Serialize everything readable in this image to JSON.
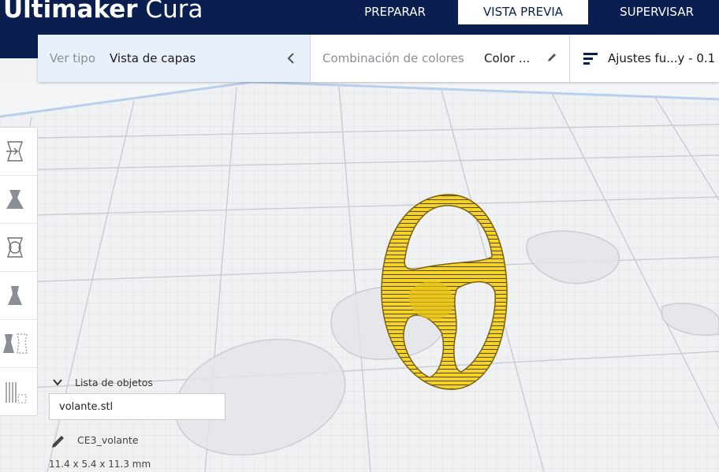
{
  "app": {
    "logo_bold": "Ultimaker",
    "logo_light": "Cura"
  },
  "stages": [
    {
      "label": "PREPARAR",
      "active": false
    },
    {
      "label": "VISTA PREVIA",
      "active": true
    },
    {
      "label": "SUPERVISAR",
      "active": false
    }
  ],
  "view_type": {
    "label": "Ver tipo",
    "value": "Vista de capas"
  },
  "color_scheme": {
    "label": "Combinación de colores",
    "value": "Color ..."
  },
  "print_settings": {
    "value": "Ajustes fu...y - 0.1"
  },
  "object_list": {
    "header": "Lista de objetos",
    "input_value": "volante.stl"
  },
  "object": {
    "name": "CE3_volante",
    "dimensions": "11.4 x 5.4 x 11.3 mm"
  },
  "colors": {
    "header_bg": "#0a1f4f",
    "model_yellow": "#f5d327",
    "active_panel": "#e8f0fb"
  },
  "toolbar_icons": [
    "move-icon",
    "scale-icon",
    "rotate-icon",
    "mirror-icon",
    "per-model-settings-icon",
    "support-blocker-icon"
  ]
}
